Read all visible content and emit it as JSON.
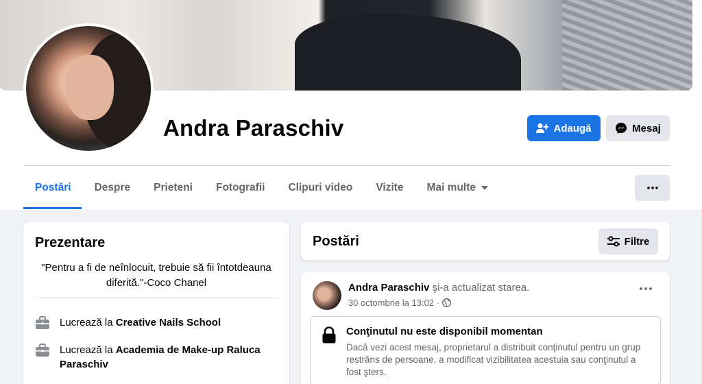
{
  "profile": {
    "name": "Andra Paraschiv"
  },
  "actions": {
    "add_label": "Adaugă",
    "message_label": "Mesaj"
  },
  "tabs": [
    {
      "label": "Postări",
      "active": true
    },
    {
      "label": "Despre"
    },
    {
      "label": "Prieteni"
    },
    {
      "label": "Fotografii"
    },
    {
      "label": "Clipuri video"
    },
    {
      "label": "Vizite"
    },
    {
      "label": "Mai multe"
    }
  ],
  "intro": {
    "title": "Prezentare",
    "quote": "\"Pentru a fi de neînlocuit, trebuie să fii întotdeauna diferită.\"-Coco Chanel",
    "work": [
      {
        "prefix": "Lucrează la",
        "place": "Creative Nails School"
      },
      {
        "prefix": "Lucrează la",
        "place": "Academia de Make-up Raluca Paraschiv"
      }
    ]
  },
  "posts": {
    "title": "Postări",
    "filter_label": "Filtre",
    "item": {
      "author": "Andra Paraschiv",
      "action": "şi-a actualizat starea.",
      "date": "30 octombrie la 13:02 ·",
      "unavailable_title": "Conţinutul nu este disponibil momentan",
      "unavailable_text": "Dacă vezi acest mesaj, proprietarul a distribuit conţinutul pentru un grup restrâns de persoane, a modificat vizibilitatea acestuia sau conţinutul a fost şters."
    }
  },
  "colors": {
    "accent": "#1b74e4",
    "secondary_button": "#e4e6eb",
    "page_bg": "#f0f2f5"
  },
  "icons": [
    "add-friend-icon",
    "messenger-icon",
    "dropdown-caret-icon",
    "more-icon",
    "filter-icon",
    "briefcase-icon",
    "globe-icon",
    "lock-icon"
  ]
}
